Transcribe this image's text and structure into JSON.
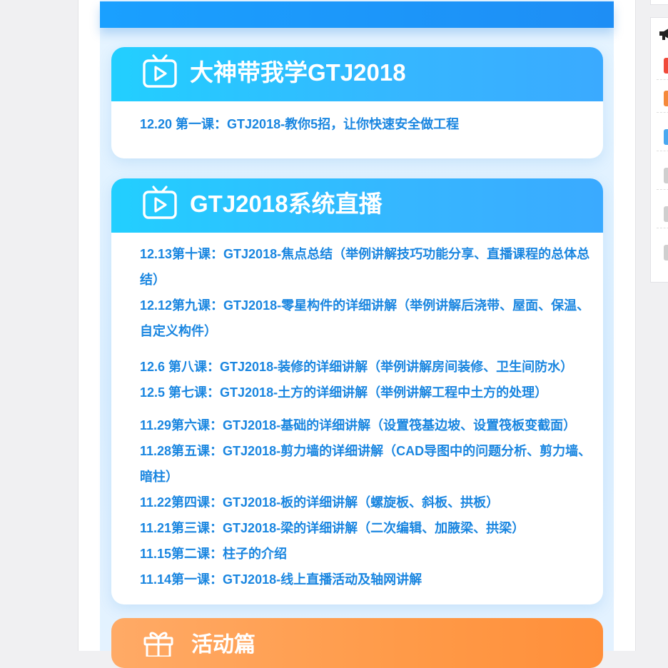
{
  "card1": {
    "title": "大神带我学GTJ2018",
    "lessons": [
      "12.20  第一课：GTJ2018-教你5招，让你快速安全做工程"
    ]
  },
  "card2": {
    "title": "GTJ2018系统直播",
    "lessons": [
      "12.13第十课：GTJ2018-焦点总结（举例讲解技巧功能分享、直播课程的总体总结）",
      "12.12第九课：GTJ2018-零星构件的详细讲解（举例讲解后浇带、屋面、保温、自定义构件）",
      "12.6  第八课：GTJ2018-装修的详细讲解（举例讲解房间装修、卫生间防水）",
      "12.5  第七课：GTJ2018-土方的详细讲解（举例讲解工程中土方的处理）",
      "11.29第六课：GTJ2018-基础的详细讲解（设置筏基边坡、设置筏板变截面）",
      "11.28第五课：GTJ2018-剪力墙的详细讲解（CAD导图中的问题分析、剪力墙、暗柱）",
      "11.22第四课：GTJ2018-板的详细讲解（螺旋板、斜板、拱板）",
      "11.21第三课：GTJ2018-梁的详细讲解（二次编辑、加腋梁、拱梁）",
      "11.15第二课：柱子的介绍",
      "11.14第一课：GTJ2018-线上直播活动及轴网讲解"
    ]
  },
  "card3": {
    "title": "活动篇"
  },
  "side_panel": {
    "icon": "megaphone-icon",
    "item_colors": [
      "#f04a3a",
      "#f5893a",
      "#49a8f0",
      "#cfcfcf",
      "#cfcfcf",
      "#cfcfcf"
    ]
  },
  "colors": {
    "lesson_text": "#1a86e0",
    "header_gradient_start": "#22cfff",
    "header_gradient_end": "#3aaaff",
    "activity_orange": "#ff9a48"
  }
}
